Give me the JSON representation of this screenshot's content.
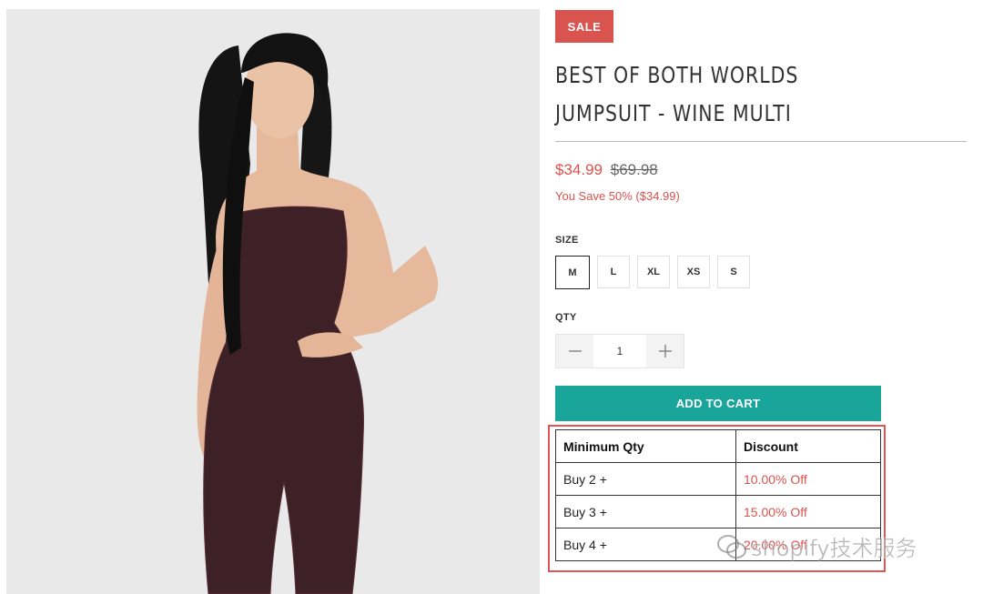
{
  "product": {
    "sale_badge": "SALE",
    "title": "BEST OF BOTH WORLDS JUMPSUIT - WINE MULTI",
    "price_current": "$34.99",
    "price_original": "$69.98",
    "you_save": "You Save 50% ($34.99)",
    "image_icon": "model-photo"
  },
  "size": {
    "label": "SIZE",
    "options": [
      "M",
      "L",
      "XL",
      "XS",
      "S"
    ],
    "selected": "M"
  },
  "qty": {
    "label": "QTY",
    "value": "1",
    "decrement_icon": "minus-icon",
    "increment_icon": "plus-icon"
  },
  "cart": {
    "add_label": "ADD TO CART"
  },
  "discount_table": {
    "headers": [
      "Minimum Qty",
      "Discount"
    ],
    "rows": [
      [
        "Buy 2 +",
        "10.00% Off"
      ],
      [
        "Buy 3 +",
        "15.00% Off"
      ],
      [
        "Buy 4 +",
        "20.00% Off"
      ]
    ]
  },
  "watermark": {
    "text": "shopify技术服务",
    "icon": "wechat-icon"
  },
  "colors": {
    "accent_red": "#d9534f",
    "cart_teal": "#1aa59a",
    "highlight_border": "#e05656"
  }
}
